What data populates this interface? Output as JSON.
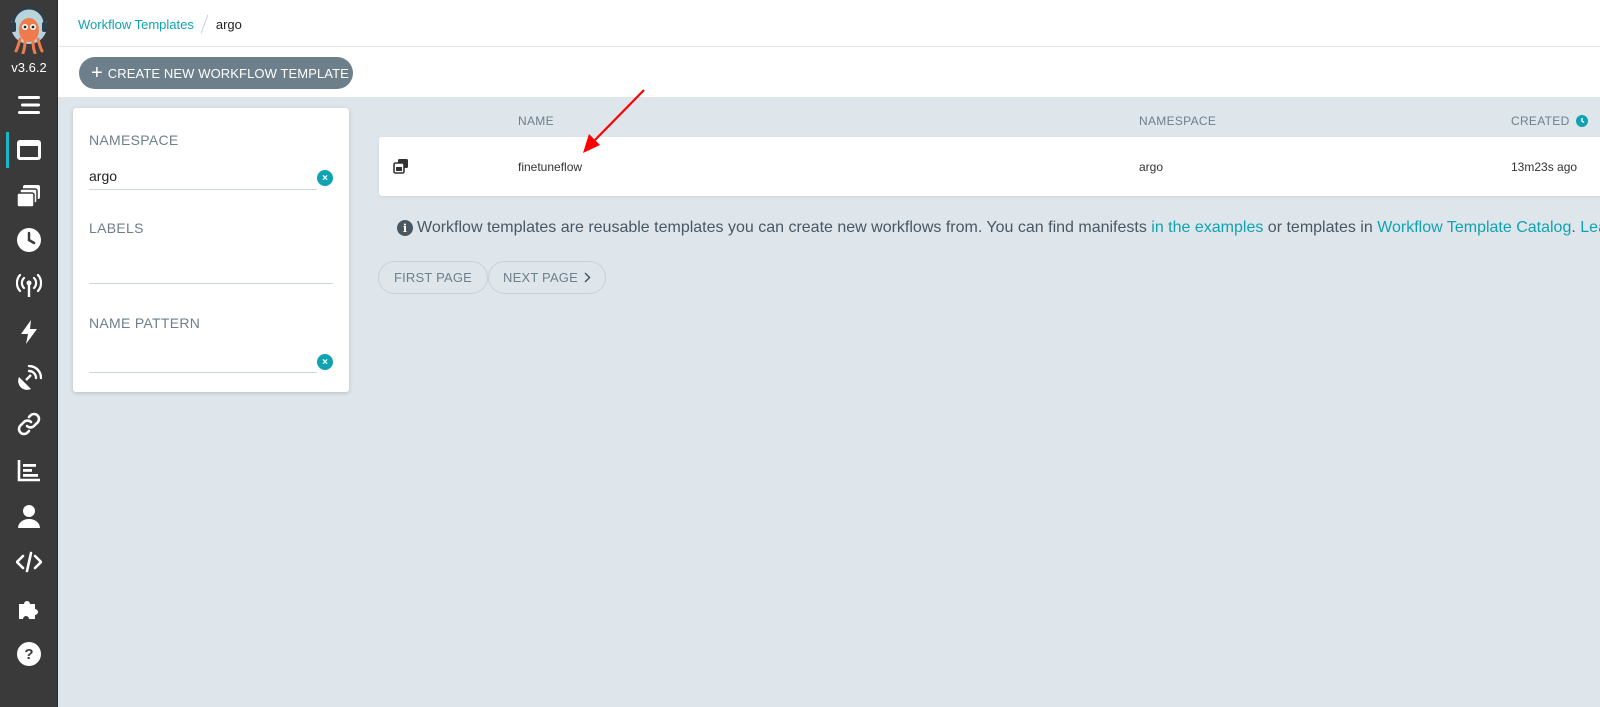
{
  "app": {
    "version": "v3.6.2"
  },
  "breadcrumb": {
    "parent": "Workflow Templates",
    "current": "argo"
  },
  "toolbar": {
    "create_label": "CREATE NEW WORKFLOW TEMPLATE"
  },
  "nav": {
    "items": [
      "menu-icon",
      "workflow-templates-icon",
      "cluster-workflow-templates-icon",
      "cron-workflows-icon",
      "event-sources-icon",
      "sensors-icon",
      "event-flow-icon",
      "links-icon",
      "reports-icon",
      "user-icon",
      "api-docs-icon",
      "plugins-icon",
      "help-icon"
    ],
    "active": "workflow-templates-icon"
  },
  "filters": {
    "namespace_label": "NAMESPACE",
    "namespace_value": "argo",
    "labels_label": "LABELS",
    "labels_value": "",
    "name_pattern_label": "NAME PATTERN",
    "name_pattern_value": ""
  },
  "table": {
    "headers": {
      "name": "NAME",
      "namespace": "NAMESPACE",
      "created": "CREATED"
    },
    "rows": [
      {
        "name": "finetuneflow",
        "namespace": "argo",
        "created": "13m23s ago"
      }
    ]
  },
  "info": {
    "text1": "Workflow templates are reusable templates you can create new workflows from. You can find manifests",
    "link1": "in the examples",
    "text2": "or templates in",
    "link2": "Workflow Template Catalog",
    "text3": ".",
    "link3": "Learn"
  },
  "pagination": {
    "first": "FIRST PAGE",
    "next": "NEXT PAGE"
  },
  "colors": {
    "accent": "#0fa3b1",
    "sidebar": "#3a3a3a",
    "button": "#6d7f8b",
    "annotation_arrow": "#ff0000"
  }
}
